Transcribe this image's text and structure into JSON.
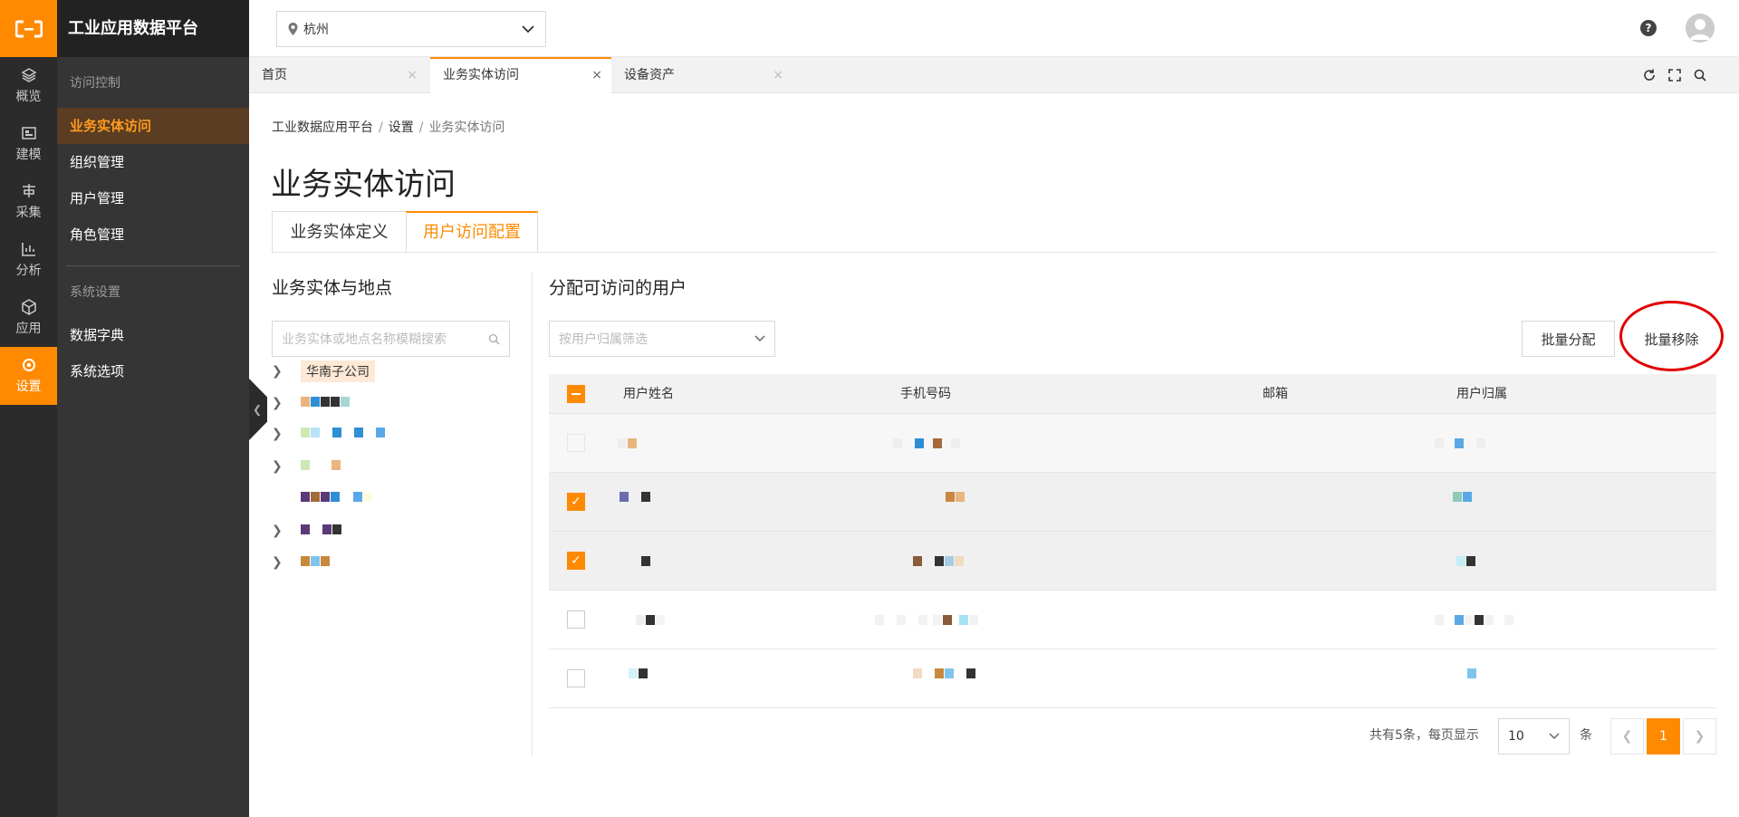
{
  "app": {
    "title": "工业应用数据平台"
  },
  "rail": [
    {
      "label": "概览",
      "icon": "layers-icon",
      "active": false
    },
    {
      "label": "建模",
      "icon": "model-icon",
      "active": false
    },
    {
      "label": "采集",
      "icon": "collect-icon",
      "active": false
    },
    {
      "label": "分析",
      "icon": "analysis-icon",
      "active": false
    },
    {
      "label": "应用",
      "icon": "cube-icon",
      "active": false
    },
    {
      "label": "设置",
      "icon": "settings-icon",
      "active": true
    }
  ],
  "sidebar": {
    "group1": "访问控制",
    "items1": [
      "业务实体访问",
      "组织管理",
      "用户管理",
      "角色管理"
    ],
    "group2": "系统设置",
    "items2": [
      "数据字典",
      "系统选项"
    ]
  },
  "topbar": {
    "city": "杭州"
  },
  "page_tabs": [
    {
      "label": "首页",
      "active": false
    },
    {
      "label": "业务实体访问",
      "active": true
    },
    {
      "label": "设备资产",
      "active": false
    }
  ],
  "breadcrumb": {
    "root": "工业数据应用平台",
    "mid": "设置",
    "current": "业务实体访问",
    "sep": "/"
  },
  "page_title": "业务实体访问",
  "content_tabs": [
    {
      "label": "业务实体定义",
      "active": false
    },
    {
      "label": "用户访问配置",
      "active": true
    }
  ],
  "left_panel": {
    "title": "业务实体与地点",
    "search_placeholder": "业务实体或地点名称模糊搜索",
    "first_node": "华南子公司"
  },
  "right_panel": {
    "title": "分配可访问的用户",
    "filter_placeholder": "按用户归属筛选",
    "batch_assign": "批量分配",
    "batch_remove": "批量移除"
  },
  "table": {
    "columns": [
      "用户姓名",
      "手机号码",
      "邮箱",
      "用户归属"
    ],
    "rows": [
      {
        "checked": false,
        "state": "disabled"
      },
      {
        "checked": true,
        "state": "selected"
      },
      {
        "checked": true,
        "state": "selected"
      },
      {
        "checked": false,
        "state": "normal"
      },
      {
        "checked": false,
        "state": "normal"
      }
    ]
  },
  "pagination": {
    "total_text": "共有5条，每页显示",
    "page_size": "10",
    "unit": "条",
    "current_page": "1"
  },
  "colors": {
    "accent": "#ff8a00",
    "sidebar": "#353535",
    "rail": "#2b2b2b",
    "highlight": "#e00000"
  }
}
